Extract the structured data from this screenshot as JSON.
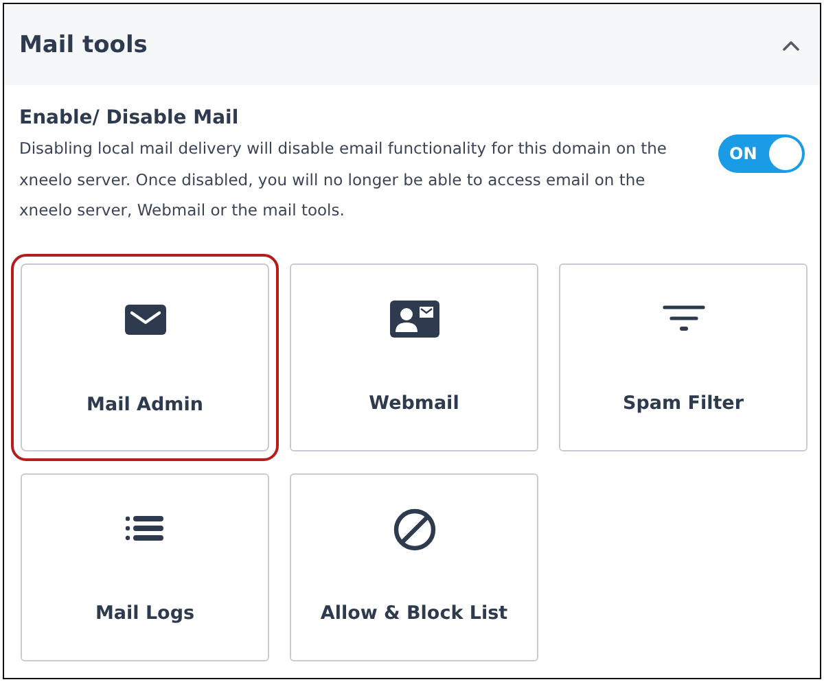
{
  "panel": {
    "title": "Mail tools",
    "expanded": true
  },
  "mail_setting": {
    "heading": "Enable/ Disable Mail",
    "description": "Disabling local mail delivery will disable email functionality for this domain on the xneelo server. Once disabled, you will no longer be able to access email on the xneelo server, Webmail or the mail tools.",
    "toggle": {
      "label": "ON",
      "on": true
    }
  },
  "tools": [
    {
      "label": "Mail Admin",
      "kind": "envelope",
      "selected": true
    },
    {
      "label": "Webmail",
      "kind": "contact-card",
      "selected": false
    },
    {
      "label": "Spam Filter",
      "kind": "filter",
      "selected": false
    },
    {
      "label": "Mail Logs",
      "kind": "list",
      "selected": false
    },
    {
      "label": "Allow & Block List",
      "kind": "block",
      "selected": false
    }
  ]
}
